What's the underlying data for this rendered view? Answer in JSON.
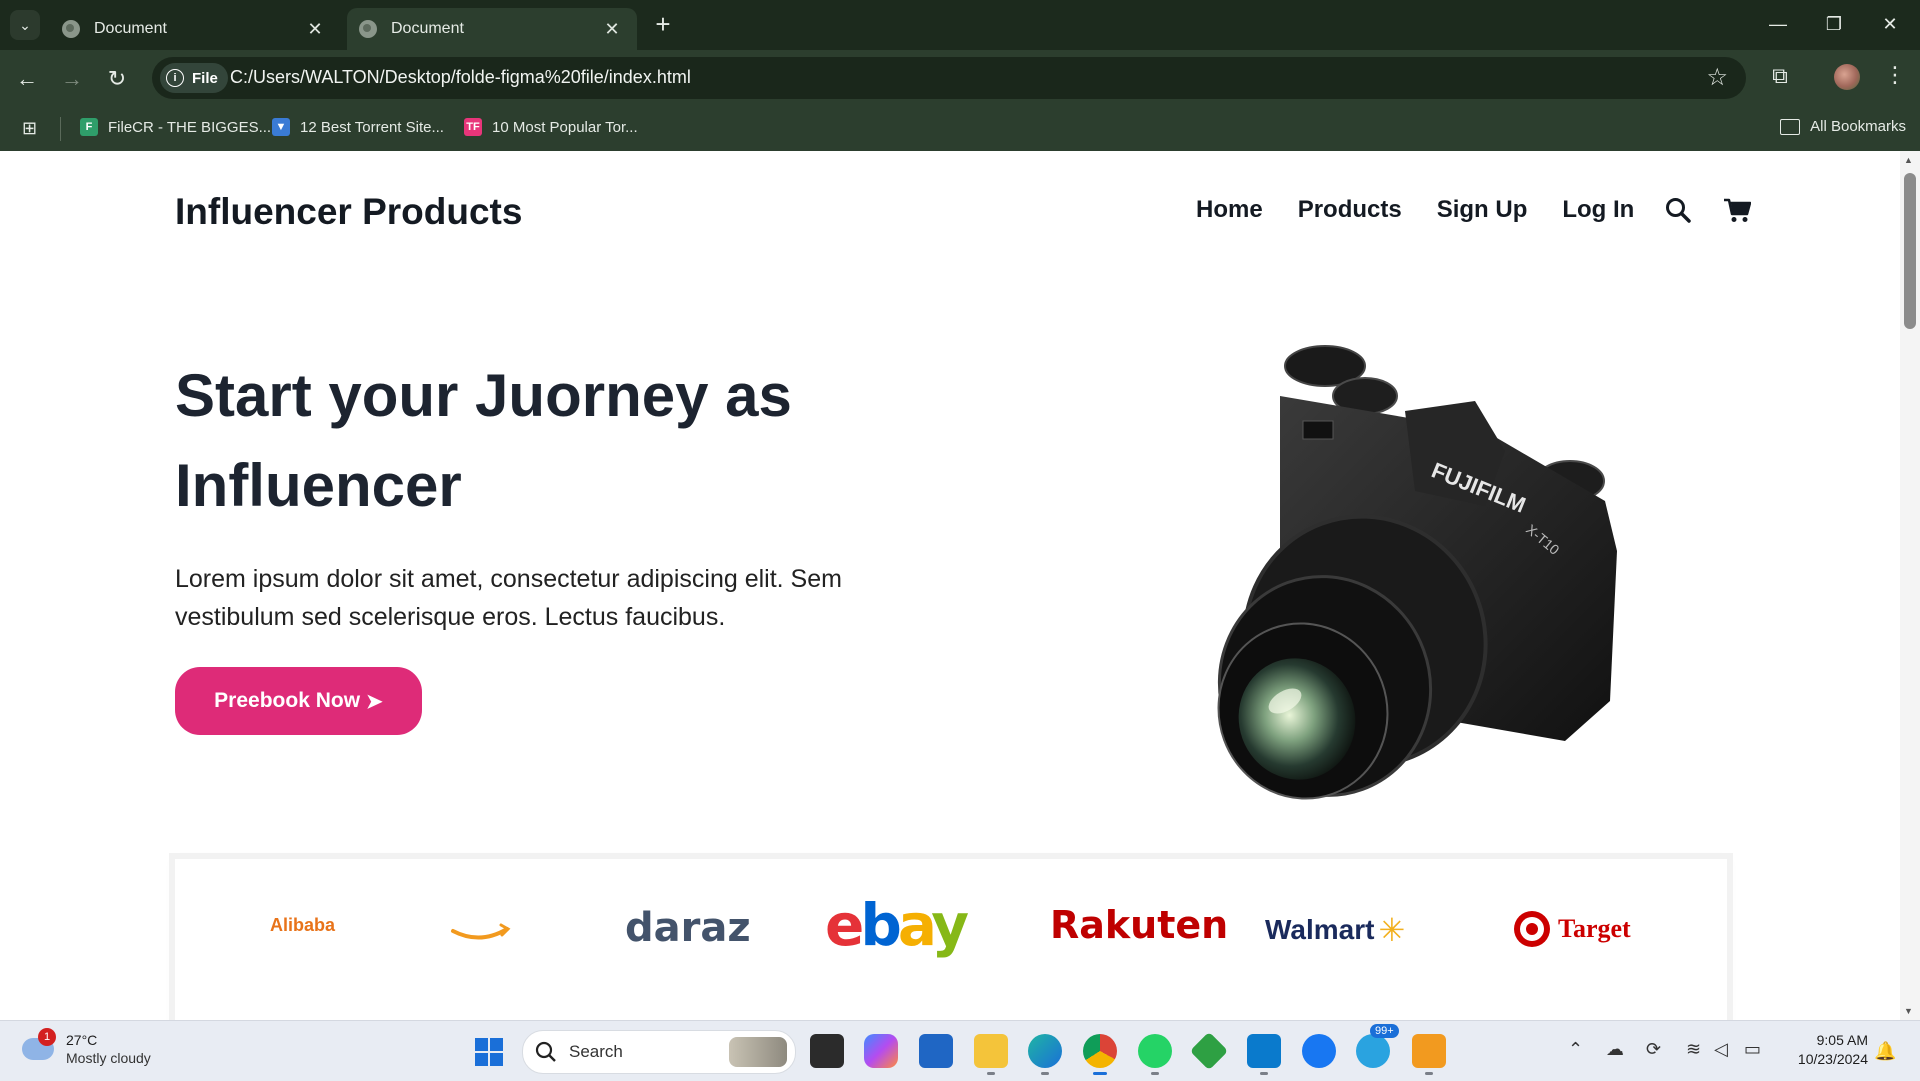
{
  "browser": {
    "tabs": [
      {
        "title": "Document",
        "active": false
      },
      {
        "title": "Document",
        "active": true
      }
    ],
    "url_chip": "File",
    "url": "C:/Users/WALTON/Desktop/folde-figma%20file/index.html",
    "bookmarks": [
      {
        "label": "FileCR - THE BIGGES...",
        "icon": "filecr-icon"
      },
      {
        "label": "12 Best Torrent Site...",
        "icon": "torrent-site-icon"
      },
      {
        "label": "10 Most Popular Tor...",
        "icon": "tf-icon",
        "icon_text": "TF"
      }
    ],
    "all_bookmarks": "All Bookmarks"
  },
  "site": {
    "brand": "Influencer Products",
    "nav": [
      "Home",
      "Products",
      "Sign Up",
      "Log In"
    ],
    "hero": {
      "title": "Start your Juorney as Influencer",
      "text": "Lorem ipsum dolor sit amet, consectetur adipiscing elit. Sem vestibulum sed scelerisque eros. Lectus faucibus.",
      "cta": "Preebook Now",
      "cta_arrow": "➤",
      "camera_label": "FUJIFILM",
      "camera_model": "X-T10"
    },
    "brands": [
      "Alibaba",
      "amazon",
      "daraz",
      "ebay",
      "Rakuten",
      "Walmart",
      "Target"
    ],
    "accent_color": "#de2b78"
  },
  "taskbar": {
    "weather_temp": "27°C",
    "weather_desc": "Mostly cloudy",
    "weather_badge": "1",
    "search": "Search",
    "telegram_badge": "99+",
    "time": "9:05 AM",
    "date": "10/23/2024"
  }
}
